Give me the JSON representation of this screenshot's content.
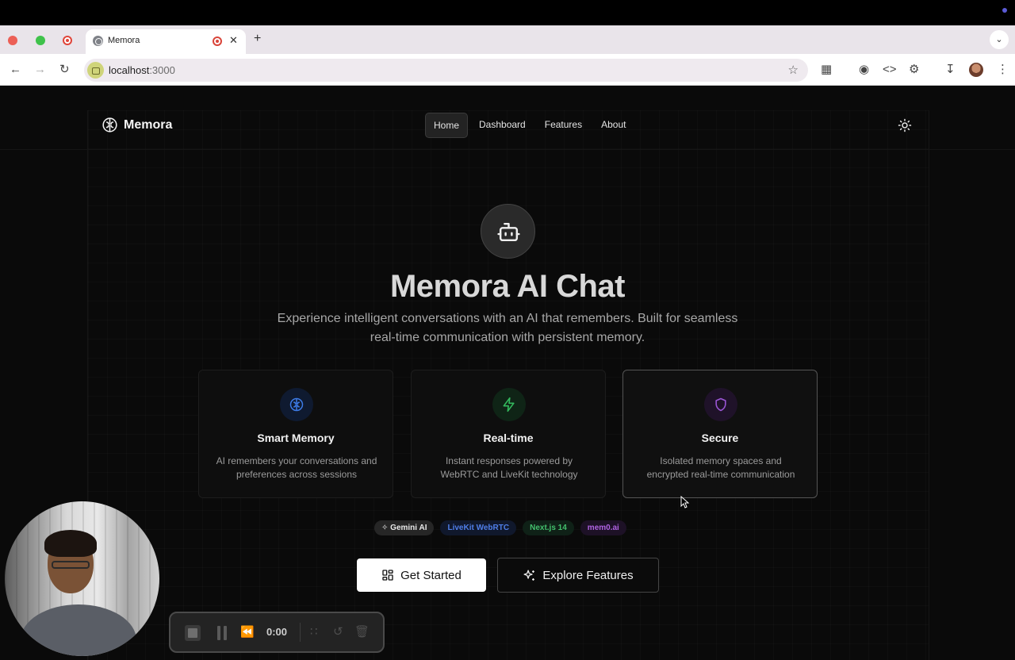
{
  "browser": {
    "tab_title": "Memora",
    "new_tab": "+",
    "tab_close": "✕",
    "tab_menu": "⌄",
    "url_host": "localhost",
    "url_port": ":3000"
  },
  "nav": {
    "logo_text": "Memora",
    "links": [
      "Home",
      "Dashboard",
      "Features",
      "About"
    ],
    "active": "Home"
  },
  "hero": {
    "title": "Memora AI Chat",
    "subtitle": "Experience intelligent conversations with an AI that remembers. Built for seamless real-time communication with persistent memory."
  },
  "features": [
    {
      "title": "Smart Memory",
      "description": "AI remembers your conversations and preferences across sessions",
      "icon": "brain-icon",
      "color": "#3d7be6"
    },
    {
      "title": "Real-time",
      "description": "Instant responses powered by WebRTC and LiveKit technology",
      "icon": "zap-icon",
      "color": "#33b85d"
    },
    {
      "title": "Secure",
      "description": "Isolated memory spaces and encrypted real-time communication",
      "icon": "shield-icon",
      "color": "#9b56d6"
    }
  ],
  "badges": [
    "Gemini AI",
    "LiveKit WebRTC",
    "Next.js 14",
    "mem0.ai"
  ],
  "cta": {
    "primary": "Get Started",
    "secondary": "Explore Features"
  },
  "recorder": {
    "time": "0:00"
  },
  "colors": {
    "background": "#0a0a0a",
    "blue": "#3d7be6",
    "green": "#33b85d",
    "purple": "#9b56d6"
  }
}
